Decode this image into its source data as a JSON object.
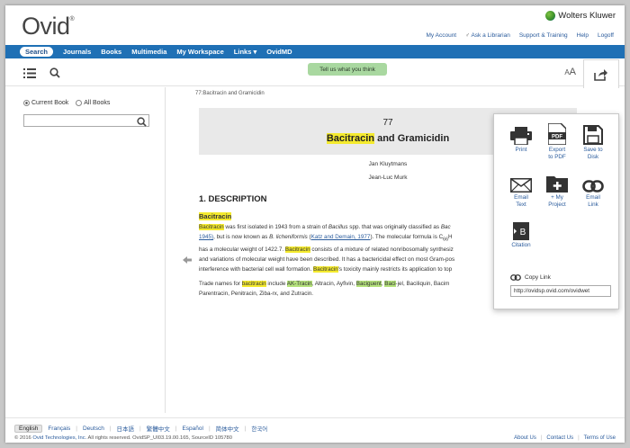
{
  "header": {
    "logo": "Ovid",
    "logo_mark": "®",
    "brand": "Wolters Kluwer",
    "links": [
      "My Account",
      "Ask a Librarian",
      "Support & Training",
      "Help",
      "Logoff"
    ]
  },
  "nav": {
    "items": [
      "Search",
      "Journals",
      "Books",
      "Multimedia",
      "My Workspace",
      "Links ▾",
      "OvidMD"
    ]
  },
  "toolbar": {
    "feedback": "Tell us what you think",
    "text_size_large": "A",
    "text_size_small": "A"
  },
  "sidebar": {
    "radio_current": "Current Book",
    "radio_all": "All Books",
    "search_value": ""
  },
  "content": {
    "breadcrumb": "77:Bacitracin and Gramicidin",
    "chapter_number": "77",
    "title_highlight": "Bacitracin",
    "title_rest": " and Gramicidin",
    "author1": "Jan Kluytmans",
    "author2": "Jean-Luc Murk",
    "section": "1. DESCRIPTION",
    "subsection": "Bacitracin",
    "p1": {
      "a": "Bacitracin",
      "b": " was first isolated in 1943 from a strain of ",
      "c": "Bacillus",
      "d": " spp. that was originally classified as ",
      "e": "Bac"
    },
    "p2": {
      "a": "1945)",
      "b": ", but is now known as ",
      "c": "B. licheniformis",
      "d": " (",
      "e": "Katz and Demain, 1977",
      "f": "). The molecular formula is C",
      "g": "66",
      "h": "H"
    },
    "p3": {
      "a": "has a molecular weight of 1422.7. ",
      "b": "Bacitracin",
      "c": " consists of a mixture of related nonribosomally synthesiz"
    },
    "p4": "and variations of molecular weight have been described. It has a bactericidal effect on most Gram-pos",
    "p5": {
      "a": "interference with bacterial cell wall formation. ",
      "b": "Bacitracin",
      "c": "'s toxicity mainly restricts its application to top"
    },
    "p6": {
      "a": "Trade names for ",
      "b": "bacitracin",
      "c": " include ",
      "d": "AK-Tracin",
      "e": ", Altracin, Ayfivin, ",
      "f": "Baciguent",
      "g": ", ",
      "h": "Baci",
      "i": "-jel, Baciliquin, Bacim"
    },
    "p7": "Parentracin, Penitracin, Ziba-rx, and Zutracin."
  },
  "share_menu": {
    "print": "Print",
    "export_line1": "Export",
    "export_line2": "to PDF",
    "pdf_badge": "PDF",
    "save_line1": "Save to",
    "save_line2": "Disk",
    "email_text_line1": "Email",
    "email_text_line2": "Text",
    "myproject_line1": "+ My",
    "myproject_line2": "Project",
    "email_link_line1": "Email",
    "email_link_line2": "Link",
    "citation": "Citation",
    "citation_badge": "B",
    "copy_link_label": "Copy Link",
    "copy_link_value": "http://ovidsp.ovid.com/ovidwet"
  },
  "footer": {
    "languages": [
      "English",
      "Français",
      "Deutsch",
      "日本語",
      "繁體中文",
      "Español",
      "简体中文",
      "한국어"
    ],
    "copyright_prefix": "© 2016 ",
    "copyright_company": "Ovid Technologies, Inc.",
    "copyright_suffix": " All rights reserved.   OvidSP_UI03.19.00.165, SourceID 105780",
    "links": [
      "About Us",
      "Contact Us",
      "Terms of Use"
    ]
  },
  "colors": {
    "nav_bg": "#1f70b5",
    "highlight_yellow": "#f4ea2e",
    "highlight_green": "#b5e27c",
    "link": "#2a5b9c",
    "feedback_bg": "#a9d8a0"
  }
}
